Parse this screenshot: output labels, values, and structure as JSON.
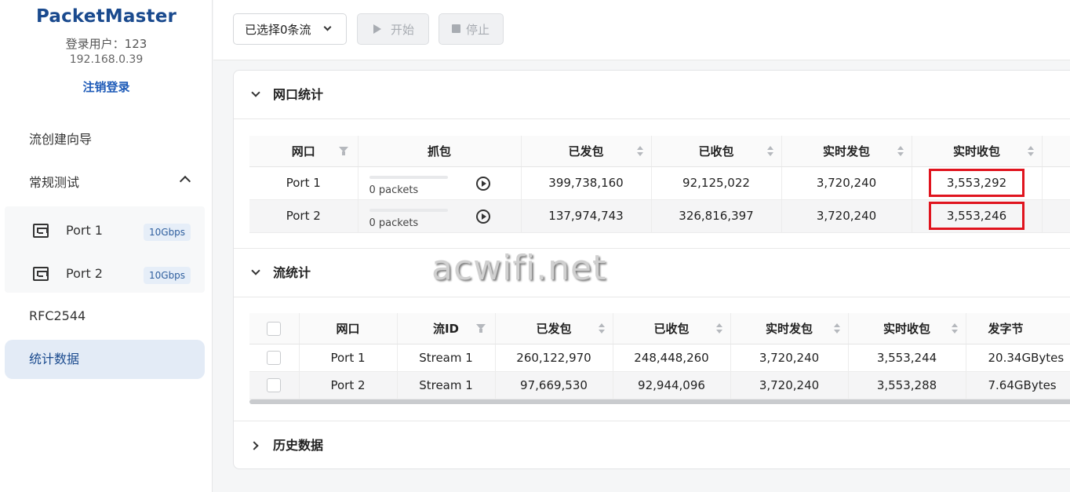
{
  "sidebar": {
    "brand": "PacketMaster",
    "user": "登录用户：123",
    "ip": "192.168.0.39",
    "logout": "注销登录",
    "nav": {
      "flow_wizard": "流创建向导",
      "regular_test": "常规测试",
      "rfc2544": "RFC2544",
      "statistics": "统计数据"
    },
    "ports": [
      {
        "label": "Port 1",
        "speed": "10Gbps"
      },
      {
        "label": "Port 2",
        "speed": "10Gbps"
      }
    ]
  },
  "toolbar": {
    "flow_select": "已选择0条流",
    "start": "开始",
    "stop": "停止"
  },
  "port_stats": {
    "title": "网口统计",
    "headers": [
      "网口",
      "抓包",
      "已发包",
      "已收包",
      "实时发包",
      "实时收包"
    ],
    "rows": [
      {
        "port": "Port 1",
        "capture": "0 packets",
        "capture_progress": 0,
        "tx": "399,738,160",
        "rx": "92,125,022",
        "rt_tx": "3,720,240",
        "rt_rx": "3,553,292"
      },
      {
        "port": "Port 2",
        "capture": "0 packets",
        "capture_progress": 0,
        "tx": "137,974,743",
        "rx": "326,816,397",
        "rt_tx": "3,720,240",
        "rt_rx": "3,553,246"
      }
    ]
  },
  "flow_stats": {
    "title": "流统计",
    "headers": [
      "网口",
      "流ID",
      "已发包",
      "已收包",
      "实时发包",
      "实时收包",
      "发字节"
    ],
    "rows": [
      {
        "port": "Port 1",
        "stream": "Stream 1",
        "tx": "260,122,970",
        "rx": "248,448,260",
        "rt_tx": "3,720,240",
        "rt_rx": "3,553,244",
        "bytes": "20.34GBytes"
      },
      {
        "port": "Port 2",
        "stream": "Stream 1",
        "tx": "97,669,530",
        "rx": "92,944,096",
        "rt_tx": "3,720,240",
        "rt_rx": "3,553,288",
        "bytes": "7.64GBytes"
      }
    ]
  },
  "history": {
    "title": "历史数据"
  },
  "watermark": "acwifi.net",
  "colors": {
    "accent": "#1a4a8e",
    "highlight": "#e0141e",
    "active_nav_bg": "#e3ebf6"
  }
}
